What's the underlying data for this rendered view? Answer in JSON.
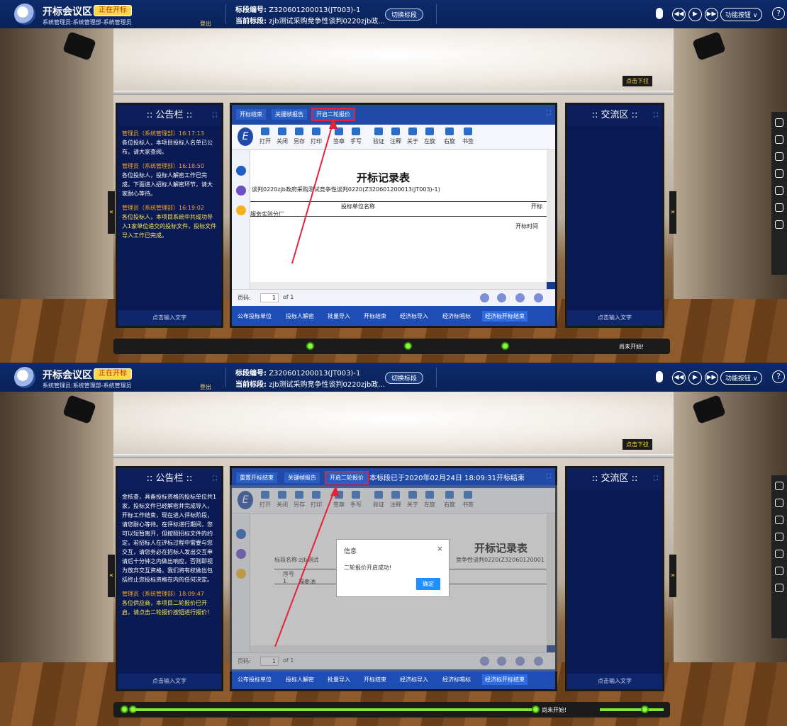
{
  "app": {
    "title": "开标会议区",
    "status": "正在开标",
    "user": "系统管理员:系统管理部-系统管理员",
    "logout": "登出",
    "section_code_label": "标段编号:",
    "section_code": "Z320601200013(JT003)-1",
    "section_name_label": "当前标段:",
    "section_name": "zjb测试采购竞争性谈判0220zjb政...",
    "switch_section": "切换标段",
    "func_button": "功能按钮",
    "pull_down": "点击下拉"
  },
  "controls": [
    "◀◀",
    "▶",
    "▶▶"
  ],
  "notice": {
    "title": ":: 公告栏 ::",
    "footer": "点击输入文字",
    "messages_1": [
      {
        "who": "管理员（系统管理部）16:17:13",
        "text": "各位投标人，本项目投标人名单已公布，请大家查阅。"
      },
      {
        "who": "管理员（系统管理部）16:18:50",
        "text": "各位投标人，投标人解密工作已完成，下面进入招标人解密环节，请大家耐心等待。"
      },
      {
        "who": "管理员（系统管理部）16:19:02",
        "text": "各位投标人，本项目系统中共成功导入1家单位递交的投标文件，投标文件导入工作已完成。"
      }
    ],
    "messages_2_lead": "金核查，具备投标资格的投标单位共1家，投标文件已经解密并完成导入，开标工作结束，现在进入评标阶段，请您耐心等待。在评标进行期间，您可以短暂离开，但按照招标文件的约定，若招标人在评标过程中需要与您交互，请您务必在招标人发出交互申请后十分钟之内做出响应，否则即视为放弃交互资格，我们将有权做出包括终止您投标资格在内的任何决定。",
    "messages_2": [
      {
        "who": "管理员（系统管理部）18:09:47",
        "text": "各位供应商，本项目二轮报价已开启，请点击二轮报价按钮进行报价！"
      }
    ]
  },
  "chat": {
    "title": ":: 交流区 ::",
    "footer": "点击输入文字"
  },
  "viewer1": {
    "tabs": [
      "开标结束",
      "关键帧报告",
      "开启二轮报价"
    ]
  },
  "viewer2": {
    "tabs": [
      "重置开标结束",
      "关键帧报告",
      "开启二轮报价"
    ],
    "status": "本标段已于2020年02月24日 18:09:31开标结束"
  },
  "toolbar": [
    "打开",
    "关闭",
    "另存",
    "打印",
    "签章",
    "手写",
    "验证",
    "注释",
    "关于",
    "左旋",
    "右旋",
    "书签"
  ],
  "doc": {
    "title": "开标记录表",
    "project_line_1": "谈判0220zjb政府采购测试竞争性谈判0220(Z320601200013(JT003)-1)",
    "col_header": "投标单位名称",
    "col_header_2": "开标",
    "row_1": "服务实验分厂",
    "open_time": "开标时间",
    "project_line_2a": "标段名称:zjb测试",
    "project_line_2b": "竞争性谈判0220(Z32060120001",
    "seq": "序号",
    "row_2_no": "1",
    "row_2_name": "福麦油"
  },
  "pager": {
    "label": "页码:",
    "page": "1",
    "of": "of 1"
  },
  "bottom_buttons": [
    "公布投标单位",
    "投标人解密",
    "批量导入",
    "开标结束",
    "经济标导入",
    "经济标唱标",
    "经济标开标结束"
  ],
  "progress": {
    "label": "尚未开始!"
  },
  "dialog": {
    "title": "信息",
    "close": "×",
    "message": "二轮报价开启成功!",
    "ok": "确定"
  }
}
